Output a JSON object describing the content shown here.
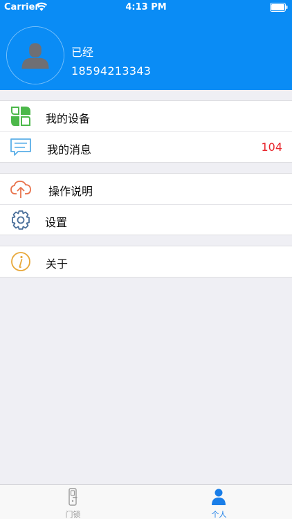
{
  "status_bar": {
    "carrier": "Carrier",
    "time": "4:13 PM"
  },
  "profile": {
    "name": "已经",
    "phone": "18594213343"
  },
  "menu": {
    "devices_label": "我的设备",
    "messages_label": "我的消息",
    "messages_count": "104",
    "instructions_label": "操作说明",
    "settings_label": "设置",
    "about_label": "关于"
  },
  "tabbar": {
    "locks_label": "门锁",
    "me_label": "个人"
  },
  "colors": {
    "header": "#0a8cf5",
    "badge": "#e8262d",
    "tab_active": "#1a7ee8",
    "devices_icon": "#4cb84a",
    "messages_icon": "#5aaee8",
    "instructions_icon": "#e8714a",
    "settings_icon": "#4a6f9a",
    "about_icon": "#e8a83a"
  },
  "icons": {
    "devices": "four-leaf-grid-icon",
    "messages": "chat-bubble-icon",
    "instructions": "cloud-upload-icon",
    "settings": "gear-icon",
    "about": "info-icon",
    "locks_tab": "door-lock-icon",
    "me_tab": "person-icon"
  }
}
